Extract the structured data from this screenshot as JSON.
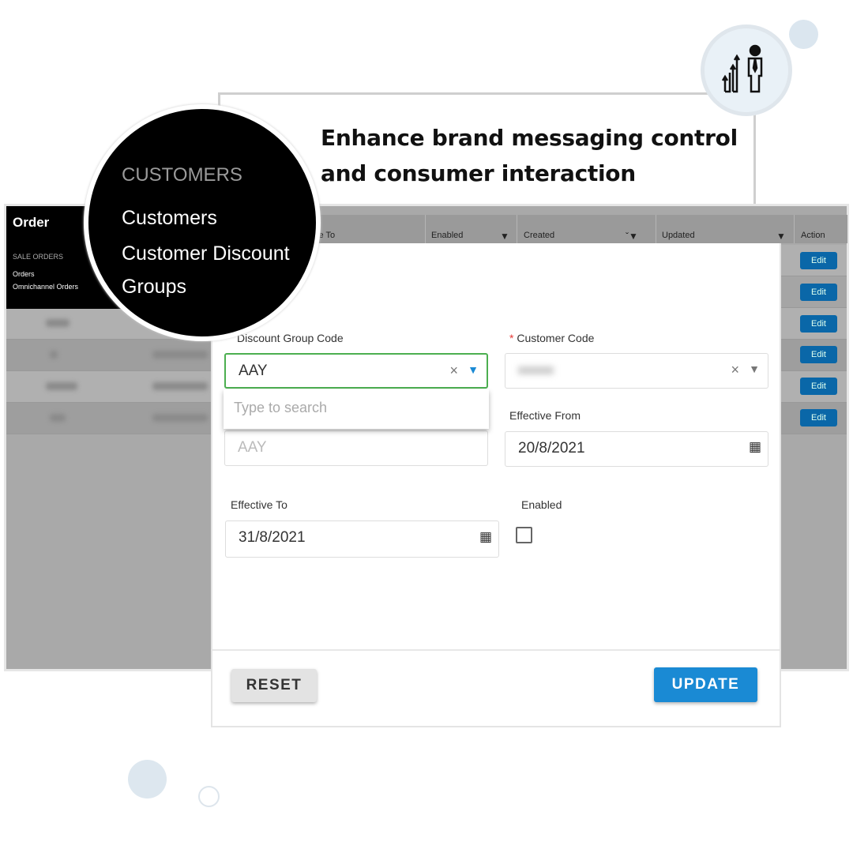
{
  "headline": {
    "line1": "Enhance brand messaging control",
    "line2": "and consumer interaction"
  },
  "sidebar": {
    "title": "Order",
    "section": "SALE ORDERS",
    "items": [
      "Orders",
      "Omnichannel Orders"
    ]
  },
  "zoom_menu": {
    "section": "CUSTOMERS",
    "items": [
      "Customers",
      "Customer Discount",
      "Groups"
    ]
  },
  "table": {
    "headers": [
      "ve To",
      "Enabled",
      "Created",
      "Updated",
      "Action"
    ],
    "edit_label": "Edit",
    "row_count": 6
  },
  "form": {
    "discount_group_code": {
      "label": "Discount Group Code",
      "value": "AAY",
      "search_placeholder": "Type to search",
      "secondary_value": "AAY"
    },
    "customer_code": {
      "label": "Customer Code",
      "required_mark": "*"
    },
    "effective_from": {
      "label": "Effective From",
      "value": "20/8/2021"
    },
    "effective_to": {
      "label": "Effective To",
      "value": "31/8/2021"
    },
    "enabled": {
      "label": "Enabled",
      "checked": false
    }
  },
  "buttons": {
    "reset": "RESET",
    "update": "UPDATE"
  },
  "colors": {
    "accent": "#1a8ad4",
    "valid_border": "#4caf50",
    "edit_button": "#0a67a8"
  }
}
